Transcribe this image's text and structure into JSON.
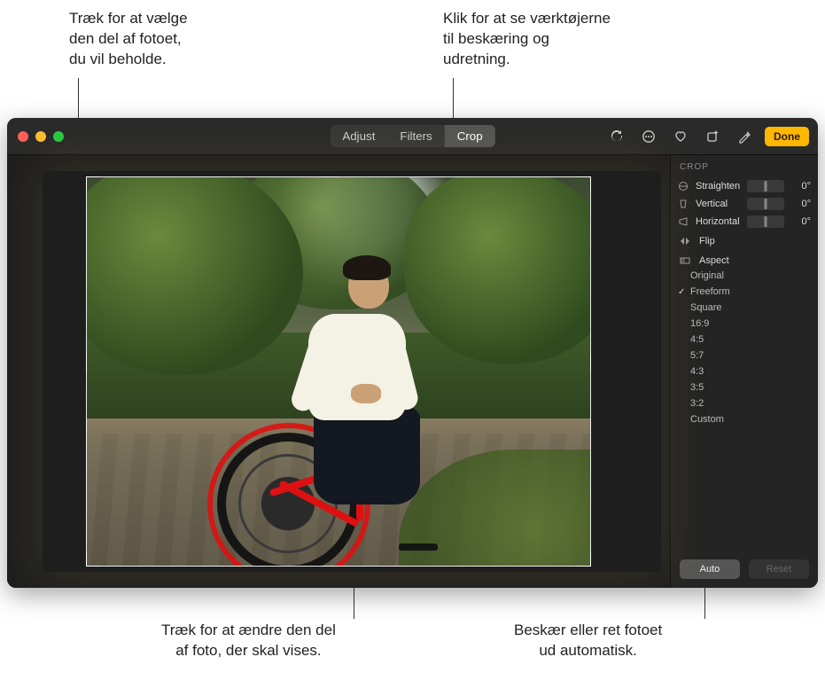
{
  "callouts": {
    "top_left": "Træk for at vælge\nden del af fotoet,\ndu vil beholde.",
    "top_right": "Klik for at se værktøjerne\ntil beskæring og\nudretning.",
    "bottom_left": "Træk for at ændre den del\naf foto, der skal vises.",
    "bottom_right": "Beskær eller ret fotoet\nud automatisk."
  },
  "tabs": {
    "adjust": "Adjust",
    "filters": "Filters",
    "crop": "Crop"
  },
  "toolbar": {
    "done": "Done"
  },
  "panel": {
    "title": "CROP",
    "sliders": {
      "straighten": {
        "label": "Straighten",
        "value": "0°"
      },
      "vertical": {
        "label": "Vertical",
        "value": "0°"
      },
      "horizontal": {
        "label": "Horizontal",
        "value": "0°"
      }
    },
    "flip_label": "Flip",
    "aspect_label": "Aspect",
    "aspects": [
      {
        "label": "Original",
        "selected": false
      },
      {
        "label": "Freeform",
        "selected": true
      },
      {
        "label": "Square",
        "selected": false
      },
      {
        "label": "16:9",
        "selected": false
      },
      {
        "label": "4:5",
        "selected": false
      },
      {
        "label": "5:7",
        "selected": false
      },
      {
        "label": "4:3",
        "selected": false
      },
      {
        "label": "3:5",
        "selected": false
      },
      {
        "label": "3:2",
        "selected": false
      },
      {
        "label": "Custom",
        "selected": false
      }
    ],
    "auto": "Auto",
    "reset": "Reset"
  }
}
